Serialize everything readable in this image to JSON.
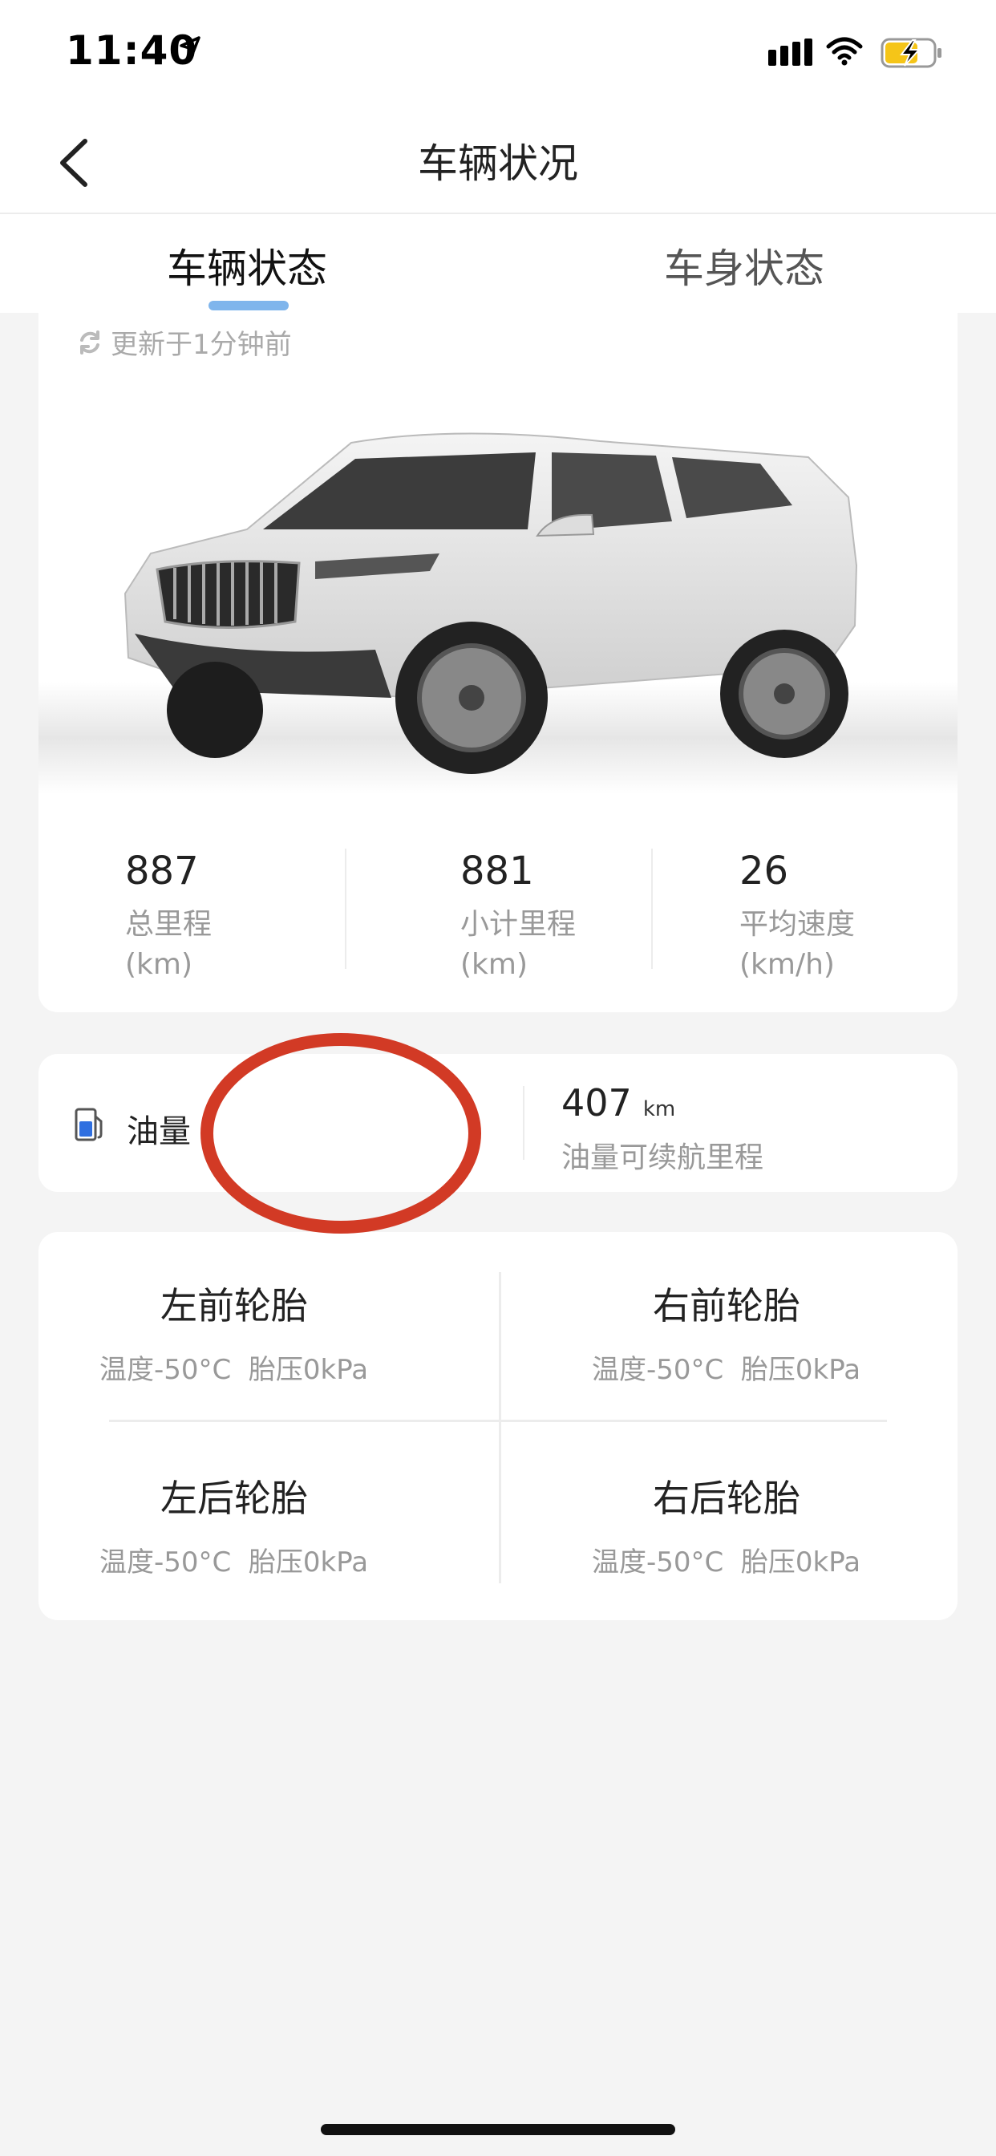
{
  "status_bar": {
    "time": "11:40"
  },
  "nav": {
    "title": "车辆状况"
  },
  "tabs": [
    {
      "label": "车辆状态",
      "active": true
    },
    {
      "label": "车身状态",
      "active": false
    }
  ],
  "update_text": "更新于1分钟前",
  "stats": [
    {
      "value": "887",
      "label": "总里程",
      "unit": "(km)"
    },
    {
      "value": "881",
      "label": "小计里程",
      "unit": "(km)"
    },
    {
      "value": "26",
      "label": "平均速度",
      "unit": "(km/h)"
    }
  ],
  "fuel": {
    "label": "油量",
    "range_value": "407",
    "range_unit": "km",
    "range_label": "油量可续航里程"
  },
  "tires": [
    {
      "name": "左前轮胎",
      "temp": "温度-50°C",
      "pressure": "胎压0kPa"
    },
    {
      "name": "右前轮胎",
      "temp": "温度-50°C",
      "pressure": "胎压0kPa"
    },
    {
      "name": "左后轮胎",
      "temp": "温度-50°C",
      "pressure": "胎压0kPa"
    },
    {
      "name": "右后轮胎",
      "temp": "温度-50°C",
      "pressure": "胎压0kPa"
    }
  ],
  "colors": {
    "accent": "#7fb5ec",
    "annotation": "#d23a25",
    "battery_charge": "#f5c518"
  },
  "icons": [
    "location-arrow-icon",
    "signal-icon",
    "wifi-icon",
    "battery-charging-icon",
    "back-chevron-icon",
    "refresh-icon",
    "fuel-icon"
  ]
}
